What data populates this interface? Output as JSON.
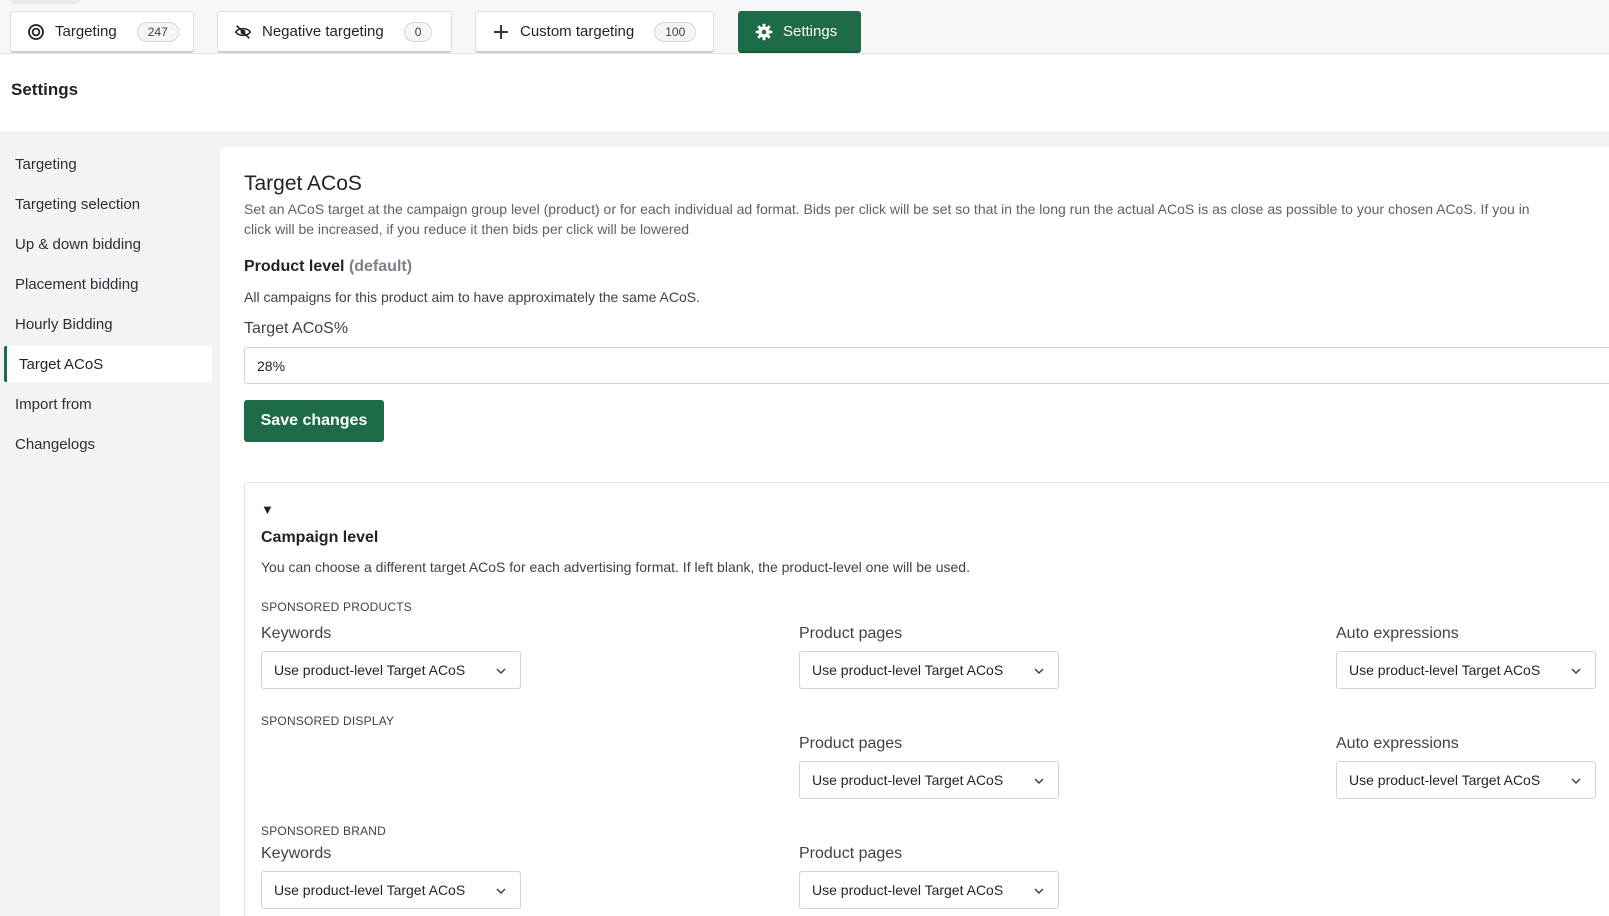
{
  "tabs": [
    {
      "label": "Targeting",
      "badge": "247",
      "icon": "target-icon"
    },
    {
      "label": "Negative targeting",
      "badge": "0",
      "icon": "eye-off-icon"
    },
    {
      "label": "Custom targeting",
      "badge": "100",
      "icon": "plus-icon"
    },
    {
      "label": "Settings",
      "icon": "gear-icon"
    }
  ],
  "page_title": "Settings",
  "sidebar": {
    "items": [
      {
        "label": "Targeting"
      },
      {
        "label": "Targeting selection"
      },
      {
        "label": "Up & down bidding"
      },
      {
        "label": "Placement bidding"
      },
      {
        "label": "Hourly Bidding"
      },
      {
        "label": "Target ACoS"
      },
      {
        "label": "Import from"
      },
      {
        "label": "Changelogs"
      }
    ],
    "active": "Target ACoS"
  },
  "target_acos": {
    "title": "Target ACoS",
    "description_line1": "Set an ACoS target at the campaign group level (product) or for each individual ad format. Bids per click will be set so that in the long run the actual ACoS is as close as possible to your chosen ACoS. If you in",
    "description_line2": "click will be increased, if you reduce it then bids per click will be lowered",
    "product_level_label": "Product level",
    "product_level_default": "(default)",
    "product_level_desc": "All campaigns for this product aim to have approximately the same ACoS.",
    "field_label": "Target ACoS%",
    "field_value": "28%",
    "save_label": "Save changes"
  },
  "campaign_level": {
    "toggle": "▼",
    "title": "Campaign level",
    "description": "You can choose a different target ACoS for each advertising format. If left blank, the product-level one will be used.",
    "sponsored_products": {
      "label": "SPONSORED PRODUCTS",
      "keywords_label": "Keywords",
      "keywords_value": "Use product-level Target ACoS",
      "product_pages_label": "Product pages",
      "product_pages_value": "Use product-level Target ACoS",
      "auto_label": "Auto expressions",
      "auto_value": "Use product-level Target ACoS"
    },
    "sponsored_display": {
      "label": "SPONSORED DISPLAY",
      "product_pages_label": "Product pages",
      "product_pages_value": "Use product-level Target ACoS",
      "auto_label": "Auto expressions",
      "auto_value": "Use product-level Target ACoS"
    },
    "sponsored_brand": {
      "label": "SPONSORED BRAND",
      "keywords_label": "Keywords",
      "keywords_value": "Use product-level Target ACoS",
      "product_pages_label": "Product pages",
      "product_pages_value": "Use product-level Target ACoS"
    }
  },
  "colors": {
    "accent": "#1e6b48",
    "background": "#f1f3f5"
  }
}
